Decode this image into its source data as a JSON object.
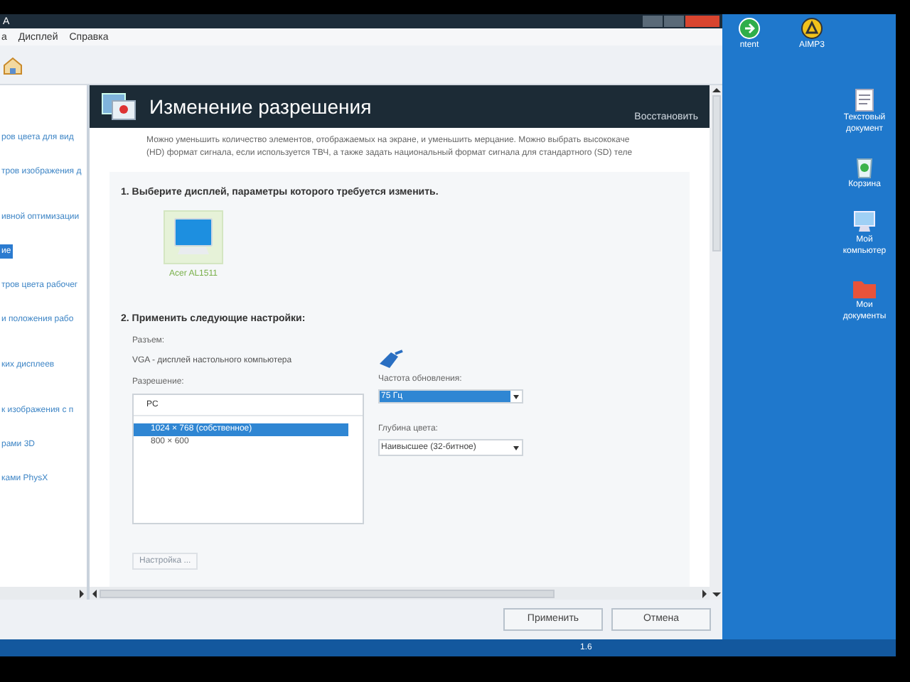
{
  "window": {
    "title": "A"
  },
  "menu": [
    {
      "label": "а"
    },
    {
      "label": "Дисплей"
    },
    {
      "label": "Справка"
    }
  ],
  "sidebar": {
    "items": [
      {
        "label": "ров цвета для вид",
        "selected": false
      },
      {
        "label": "тров изображения д",
        "selected": false
      },
      {
        "label": "ивной оптимизации",
        "selected": false
      },
      {
        "label": "ие",
        "selected": true
      },
      {
        "label": "тров цвета рабочег",
        "selected": false
      },
      {
        "label": "и положения рабо",
        "selected": false
      },
      {
        "label": "ких дисплеев",
        "selected": false
      },
      {
        "label": "к изображения с п",
        "selected": false
      },
      {
        "label": "рами 3D",
        "selected": false
      },
      {
        "label": "ками PhysX",
        "selected": false
      }
    ]
  },
  "panel": {
    "title": "Изменение разрешения",
    "restore_link": "Восстановить",
    "description": [
      "Можно уменьшить количество элементов, отображаемых на экране, и уменьшить мерцание. Можно выбрать высококаче",
      "(HD) формат сигнала, если используется ТВЧ, а также задать национальный формат сигнала для стандартного (SD) теле"
    ]
  },
  "step1": {
    "heading": "1. Выберите дисплей, параметры которого требуется изменить.",
    "displays": [
      {
        "label": "Acer AL1511",
        "selected": true
      }
    ]
  },
  "step2": {
    "heading": "2. Применить следующие настройки:",
    "connector_label": "Разъем:",
    "connector_value": "VGA - дисплей настольного компьютера",
    "resolution_label": "Разрешение:",
    "resolution_list": {
      "header": "PC",
      "items": [
        {
          "label": "1024 × 768 (собственное)",
          "selected": true
        },
        {
          "label": "800 × 600",
          "selected": false
        }
      ]
    },
    "refresh_label": "Частота обновления:",
    "refresh_value": "75 Гц",
    "depth_label": "Глубина цвета:",
    "depth_value": "Наивысшее (32-битное)",
    "customize_button": {
      "label": "Настройка ...",
      "disabled": true
    }
  },
  "buttons": [
    {
      "label": "Применить"
    },
    {
      "label": "Отмена"
    }
  ],
  "desktop_icons": [
    {
      "label": "ntent",
      "kind": "app"
    },
    {
      "label": "AIMP3",
      "kind": "player"
    },
    {
      "label": "Текстовый документ",
      "kind": "document"
    },
    {
      "label": "Корзина",
      "kind": "bin"
    },
    {
      "label": "Мой компьютер",
      "kind": "computer"
    },
    {
      "label": "Мои документы",
      "kind": "folder"
    }
  ],
  "taskbar": {
    "text": "1.6"
  }
}
